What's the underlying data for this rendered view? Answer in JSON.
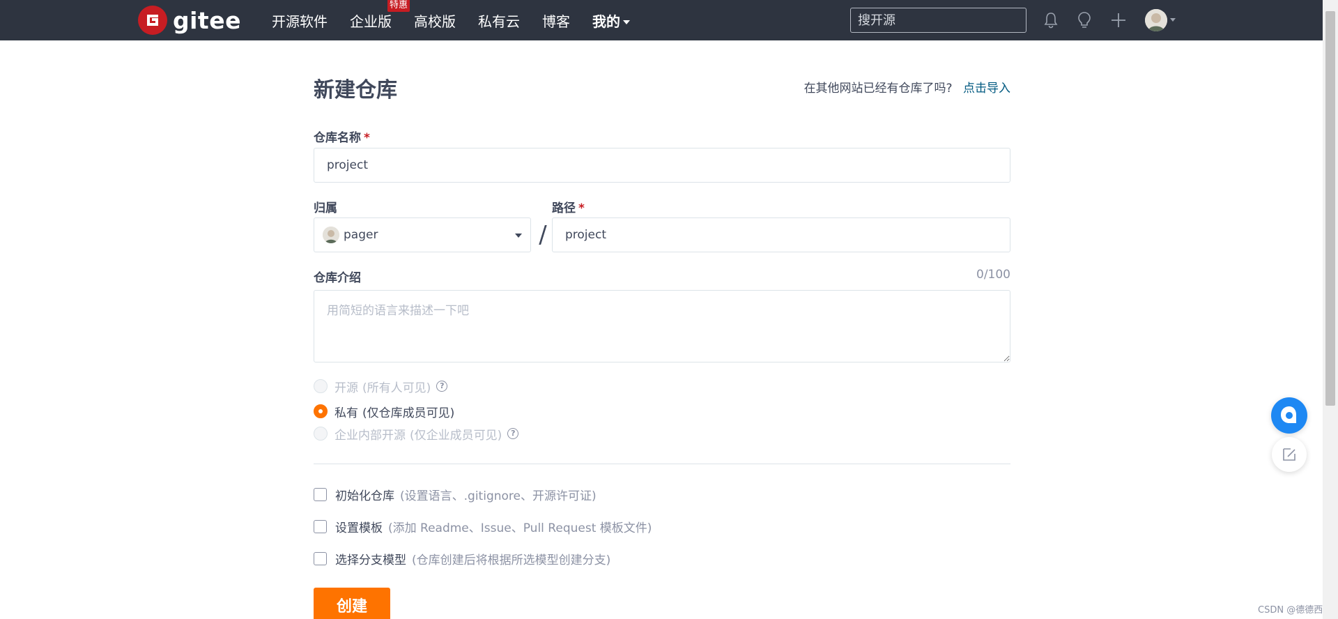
{
  "brand": {
    "name": "gitee"
  },
  "nav": {
    "items": [
      {
        "label": "开源软件"
      },
      {
        "label": "企业版",
        "badge": "特惠"
      },
      {
        "label": "高校版"
      },
      {
        "label": "私有云"
      },
      {
        "label": "博客"
      },
      {
        "label": "我的"
      }
    ]
  },
  "search": {
    "placeholder": "搜开源"
  },
  "page": {
    "title": "新建仓库",
    "import_hint": "在其他网站已经有仓库了吗?",
    "import_link": "点击导入"
  },
  "form": {
    "name_label": "仓库名称",
    "required_mark": "*",
    "name_value": "project",
    "owner_label": "归属",
    "owner_value": "pager",
    "separator": "/",
    "path_label": "路径",
    "path_value": "project",
    "desc_label": "仓库介绍",
    "desc_counter": "0/100",
    "desc_placeholder": "用简短的语言来描述一下吧",
    "visibility": [
      {
        "label": "开源",
        "sub": "(所有人可见)",
        "checked": false,
        "disabled": true,
        "help": true
      },
      {
        "label": "私有",
        "sub": "(仅仓库成员可见)",
        "checked": true,
        "disabled": false,
        "help": false
      },
      {
        "label": "企业内部开源",
        "sub": "(仅企业成员可见)",
        "checked": false,
        "disabled": true,
        "help": true
      }
    ],
    "options": [
      {
        "label": "初始化仓库",
        "sub": "(设置语言、.gitignore、开源许可证)"
      },
      {
        "label": "设置模板",
        "sub": "(添加 Readme、Issue、Pull Request 模板文件)"
      },
      {
        "label": "选择分支模型",
        "sub": "(仓库创建后将根据所选模型创建分支)"
      }
    ],
    "submit_label": "创建"
  },
  "watermark": "CSDN @德德西",
  "colors": {
    "nav_bg": "#2e3440",
    "brand_red": "#c71d23",
    "accent_orange": "#fe7300",
    "link_blue": "#005980"
  }
}
